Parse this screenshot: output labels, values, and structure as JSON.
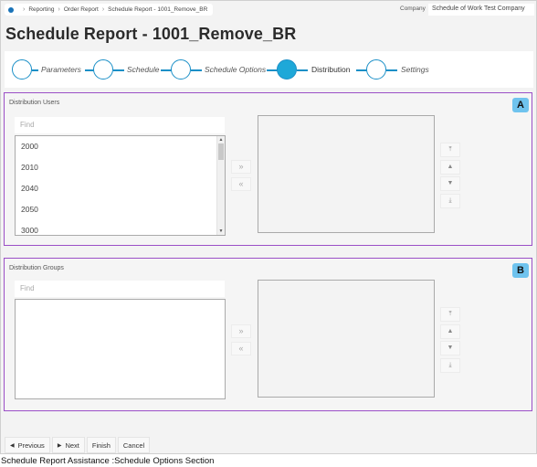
{
  "breadcrumb": {
    "items": [
      "Reporting",
      "Order Report",
      "Schedule Report - 1001_Remove_BR"
    ]
  },
  "company": {
    "label": "Company",
    "value": "Schedule of Work Test Company"
  },
  "page_title": "Schedule Report - 1001_Remove_BR",
  "steps": [
    {
      "label": "Parameters",
      "active": false
    },
    {
      "label": "Schedule",
      "active": false
    },
    {
      "label": "Schedule Options",
      "active": false
    },
    {
      "label": "Distribution",
      "active": true
    },
    {
      "label": "Settings",
      "active": false
    }
  ],
  "users_panel": {
    "title": "Distribution Users",
    "badge": "A",
    "find_placeholder": "Find",
    "items": [
      "2000",
      "2010",
      "2040",
      "2050",
      "3000"
    ]
  },
  "groups_panel": {
    "title": "Distribution Groups",
    "badge": "B",
    "find_placeholder": "Find"
  },
  "transfer_icons": {
    "add": "»",
    "remove": "«"
  },
  "order_icons": {
    "top": "⤒",
    "up": "▲",
    "down": "▼",
    "bottom": "⤓"
  },
  "footer": {
    "previous": "Previous",
    "next": "Next",
    "finish": "Finish",
    "cancel": "Cancel"
  },
  "caption": "Schedule Report Assistance :Schedule Options Section",
  "colors": {
    "accent": "#1a8fc7",
    "active_step": "#1ea8d8",
    "panel_border": "#9b4fc7",
    "badge": "#6fc3ee"
  }
}
